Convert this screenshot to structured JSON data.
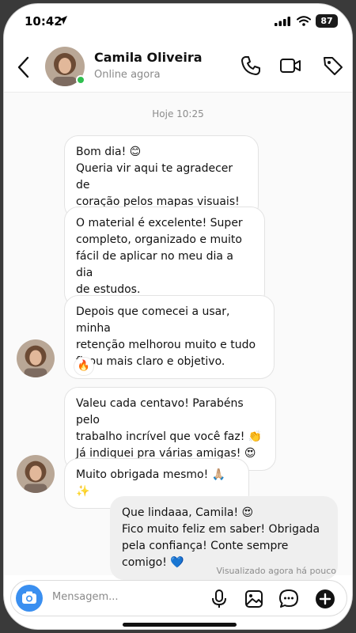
{
  "status_bar": {
    "time": "10:42",
    "battery": "87"
  },
  "header": {
    "contact_name": "Camila Oliveira",
    "presence": "Online agora"
  },
  "chat": {
    "timestamp": "Hoje 10:25",
    "messages": [
      {
        "text": "Bom dia! 😊\nQueria vir aqui te agradecer de\ncoração pelos mapas visuais!"
      },
      {
        "text": "O material é excelente! Super\ncompleto, organizado e muito\nfácil de aplicar no meu dia a dia\nde estudos."
      },
      {
        "text": "Depois que comecei a usar, minha\nretenção melhorou muito e tudo\nficou mais claro e objetivo.",
        "reaction": "🔥"
      },
      {
        "text": "Valeu cada centavo! Parabéns pelo\ntrabalho incrível que você faz! 👏\nJá indiquei pra várias amigas! 😍"
      },
      {
        "text": "Muito obrigada mesmo! 🙏🏼✨"
      },
      {
        "text": "Que lindaaa, Camila! 😍\nFico muito feliz em saber! Obrigada\npela confiança! Conte sempre comigo! 💙"
      }
    ],
    "seen_status": "Visualizado agora há pouco"
  },
  "composer": {
    "placeholder": "Mensagem..."
  },
  "icons": [
    "location-arrow-icon",
    "signal-icon",
    "wifi-icon",
    "back-icon",
    "phone-icon",
    "video-icon",
    "tag-icon",
    "camera-icon",
    "microphone-icon",
    "image-icon",
    "sticker-icon",
    "plus-icon"
  ],
  "colors": {
    "online": "#2fbf4f",
    "camera_button": "#3a8ff0",
    "my_bubble": "#efefef"
  }
}
